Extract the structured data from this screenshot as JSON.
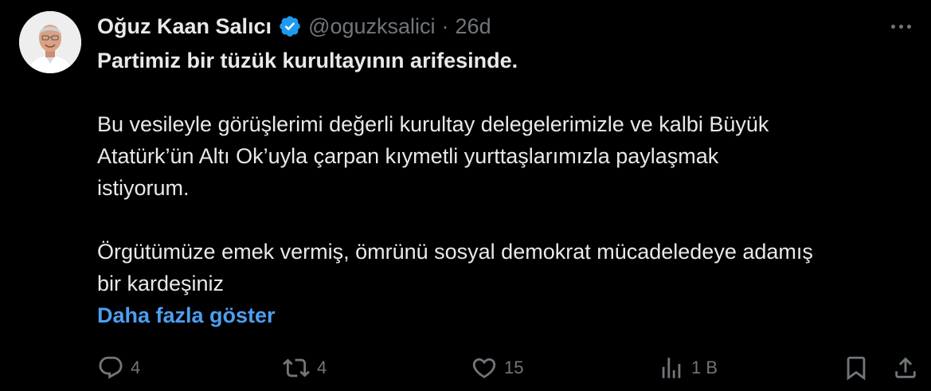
{
  "tweet": {
    "author_name": "Oğuz Kaan Salıcı",
    "handle": "@oguzksalici",
    "separator": "·",
    "time": "26d",
    "text_lines": [
      "Partimiz bir tüzük kurultayının arifesinde.",
      "Bu vesileyle görüşlerimi değerli kurultay delegelerimizle ve kalbi Büyük",
      "Atatürk’ün Altı Ok’uyla çarpan kıymetli yurttaşlarımızla paylaşmak",
      "istiyorum.",
      "Örgütümüze emek vermiş, ömrünü sosyal demokrat mücadeledeye adamış",
      "bir kardeşiniz"
    ],
    "show_more": "Daha fazla göster"
  },
  "actions": {
    "replies": "4",
    "reposts": "4",
    "likes": "15",
    "views": "1 B"
  },
  "icons": {
    "verified": "verified-badge-icon",
    "more": "more-icon",
    "reply": "reply-icon",
    "repost": "repost-icon",
    "like": "heart-icon",
    "views": "analytics-icon",
    "bookmark": "bookmark-icon",
    "share": "share-icon"
  },
  "colors": {
    "background": "#000000",
    "text": "#e7e9ea",
    "muted": "#71767b",
    "link": "#4c9ff0",
    "verified": "#1d9bf0"
  }
}
